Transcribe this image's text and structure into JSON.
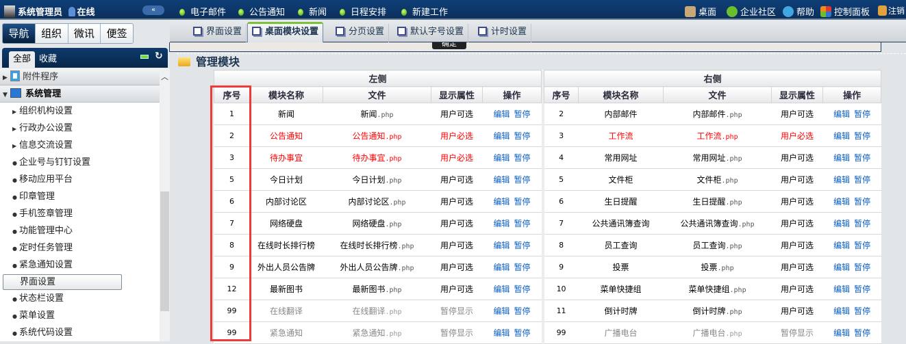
{
  "topbar": {
    "user": "系统管理员",
    "status": "在线",
    "collapse": "«",
    "shortcuts": [
      "电子邮件",
      "公告通知",
      "新闻",
      "日程安排",
      "新建工作"
    ],
    "right": [
      {
        "label": "桌面",
        "icon": "desktop-icon",
        "color": "#c9a877"
      },
      {
        "label": "企业社区",
        "icon": "community-icon",
        "color": "#6cbf2c"
      },
      {
        "label": "帮助",
        "icon": "help-icon",
        "color": "#41a7e0"
      },
      {
        "label": "控制面板",
        "icon": "control-panel-icon",
        "color": "#e23b2b"
      },
      {
        "label": "注销",
        "icon": "logout-icon",
        "color": "#e0a23a"
      }
    ]
  },
  "left": {
    "navtabs": [
      "导航",
      "组织",
      "微讯",
      "便签"
    ],
    "active_nav": 0,
    "subtabs": [
      "全部",
      "收藏"
    ],
    "groups": [
      {
        "label": "附件程序",
        "expanded": false
      },
      {
        "label": "系统管理",
        "expanded": true
      }
    ],
    "items": [
      {
        "label": "组织机构设置",
        "type": "folder"
      },
      {
        "label": "行政办公设置",
        "type": "folder"
      },
      {
        "label": "信息交流设置",
        "type": "folder"
      },
      {
        "label": "企业号与钉钉设置",
        "type": "leaf"
      },
      {
        "label": "移动应用平台",
        "type": "leaf"
      },
      {
        "label": "印章管理",
        "type": "leaf"
      },
      {
        "label": "手机签章管理",
        "type": "leaf"
      },
      {
        "label": "功能管理中心",
        "type": "leaf"
      },
      {
        "label": "定时任务管理",
        "type": "leaf"
      },
      {
        "label": "紧急通知设置",
        "type": "leaf"
      },
      {
        "label": "界面设置",
        "type": "selected"
      },
      {
        "label": "状态栏设置",
        "type": "leaf"
      },
      {
        "label": "菜单设置",
        "type": "leaf"
      },
      {
        "label": "系统代码设置",
        "type": "leaf"
      }
    ]
  },
  "main": {
    "tabs": [
      "界面设置",
      "桌面模块设置",
      "分页设置",
      "默认字号设置",
      "计时设置"
    ],
    "active_tab": 1,
    "ok_button": "确定",
    "title": "管理模块",
    "sides": [
      "左侧",
      "右侧"
    ],
    "columns": [
      "序号",
      "模块名称",
      "文件",
      "显示属性",
      "操作"
    ],
    "actions": [
      "编辑",
      "暂停"
    ],
    "left_rows": [
      {
        "seq": "1",
        "name": "新闻",
        "file": "新闻",
        "ext": ".php",
        "attr": "用户可选",
        "state": "normal"
      },
      {
        "seq": "2",
        "name": "公告通知",
        "file": "公告通知",
        "ext": ".php",
        "attr": "用户必选",
        "state": "required"
      },
      {
        "seq": "3",
        "name": "待办事宜",
        "file": "待办事宜",
        "ext": ".php",
        "attr": "用户必选",
        "state": "required"
      },
      {
        "seq": "5",
        "name": "今日计划",
        "file": "今日计划",
        "ext": ".php",
        "attr": "用户可选",
        "state": "normal"
      },
      {
        "seq": "6",
        "name": "内部讨论区",
        "file": "内部讨论区",
        "ext": ".php",
        "attr": "用户可选",
        "state": "normal"
      },
      {
        "seq": "7",
        "name": "网络硬盘",
        "file": "网络硬盘",
        "ext": ".php",
        "attr": "用户可选",
        "state": "normal"
      },
      {
        "seq": "8",
        "name": "在线时长排行榜",
        "file": "在线时长排行榜",
        "ext": ".php",
        "attr": "用户可选",
        "state": "normal"
      },
      {
        "seq": "9",
        "name": "外出人员公告牌",
        "file": "外出人员公告牌",
        "ext": ".php",
        "attr": "用户可选",
        "state": "normal"
      },
      {
        "seq": "12",
        "name": "最新图书",
        "file": "最新图书",
        "ext": ".php",
        "attr": "用户可选",
        "state": "normal"
      },
      {
        "seq": "99",
        "name": "在线翻译",
        "file": "在线翻译",
        "ext": ".php",
        "attr": "暂停显示",
        "state": "paused"
      },
      {
        "seq": "99",
        "name": "紧急通知",
        "file": "紧急通知",
        "ext": ".php",
        "attr": "暂停显示",
        "state": "paused"
      }
    ],
    "right_rows": [
      {
        "seq": "2",
        "name": "内部邮件",
        "file": "内部邮件",
        "ext": ".php",
        "attr": "用户可选",
        "state": "normal"
      },
      {
        "seq": "3",
        "name": "工作流",
        "file": "工作流",
        "ext": ".php",
        "attr": "用户必选",
        "state": "required"
      },
      {
        "seq": "4",
        "name": "常用网址",
        "file": "常用网址",
        "ext": ".php",
        "attr": "用户可选",
        "state": "normal"
      },
      {
        "seq": "5",
        "name": "文件柜",
        "file": "文件柜",
        "ext": ".php",
        "attr": "用户可选",
        "state": "normal"
      },
      {
        "seq": "6",
        "name": "生日提醒",
        "file": "生日提醒",
        "ext": ".php",
        "attr": "用户可选",
        "state": "normal"
      },
      {
        "seq": "7",
        "name": "公共通讯簿查询",
        "file": "公共通讯簿查询",
        "ext": ".php",
        "attr": "用户可选",
        "state": "normal"
      },
      {
        "seq": "8",
        "name": "员工查询",
        "file": "员工查询",
        "ext": ".php",
        "attr": "用户可选",
        "state": "normal"
      },
      {
        "seq": "9",
        "name": "投票",
        "file": "投票",
        "ext": ".php",
        "attr": "用户可选",
        "state": "normal"
      },
      {
        "seq": "10",
        "name": "菜单快捷组",
        "file": "菜单快捷组",
        "ext": ".php",
        "attr": "用户可选",
        "state": "normal"
      },
      {
        "seq": "11",
        "name": "倒计时牌",
        "file": "倒计时牌",
        "ext": ".php",
        "attr": "用户可选",
        "state": "normal"
      },
      {
        "seq": "99",
        "name": "广播电台",
        "file": "广播电台",
        "ext": ".php",
        "attr": "暂停显示",
        "state": "paused"
      }
    ]
  }
}
